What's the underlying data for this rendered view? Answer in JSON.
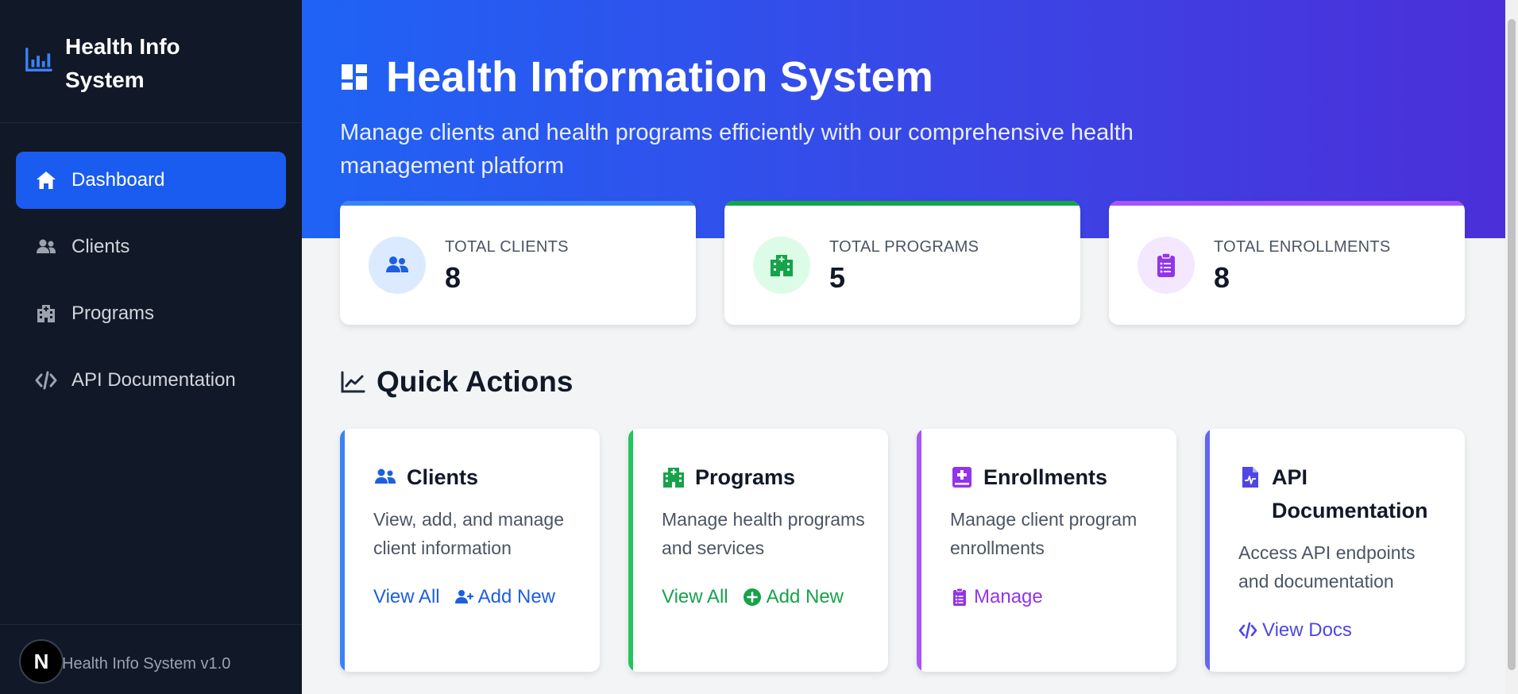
{
  "app": {
    "title": "Health Info System",
    "version": "Health Info System v1.0",
    "badge_letter": "N"
  },
  "sidebar": {
    "items": [
      {
        "label": "Dashboard",
        "icon": "home-icon",
        "active": true
      },
      {
        "label": "Clients",
        "icon": "users-icon"
      },
      {
        "label": "Programs",
        "icon": "hospital-icon"
      },
      {
        "label": "API Documentation",
        "icon": "code-icon"
      }
    ]
  },
  "hero": {
    "title": "Health Information System",
    "subtitle": "Manage clients and health programs efficiently with our comprehensive health management platform"
  },
  "stats": [
    {
      "label": "TOTAL CLIENTS",
      "value": "8",
      "color": "#3b82f6"
    },
    {
      "label": "TOTAL PROGRAMS",
      "value": "5",
      "color": "#16a34a"
    },
    {
      "label": "TOTAL ENROLLMENTS",
      "value": "8",
      "color": "#9333ea"
    }
  ],
  "quick_actions": {
    "heading": "Quick Actions",
    "cards": [
      {
        "title": "Clients",
        "description": "View, add, and manage client information",
        "links": [
          "View All",
          "Add New"
        ],
        "color": "#1d5fe0"
      },
      {
        "title": "Programs",
        "description": "Manage health programs and services",
        "links": [
          "View All",
          "Add New"
        ],
        "color": "#16a34a"
      },
      {
        "title": "Enrollments",
        "description": "Manage client program enrollments",
        "links": [
          "Manage"
        ],
        "color": "#9333ea"
      },
      {
        "title": "API Documentation",
        "description": "Access API endpoints and documentation",
        "links": [
          "View Docs"
        ],
        "color": "#4f46e5"
      }
    ]
  },
  "colors": {
    "sidebar_bg": "#111827",
    "active_nav": "#1a5cf0",
    "hero_start": "#1f63f5",
    "hero_end": "#4b2fd8"
  }
}
